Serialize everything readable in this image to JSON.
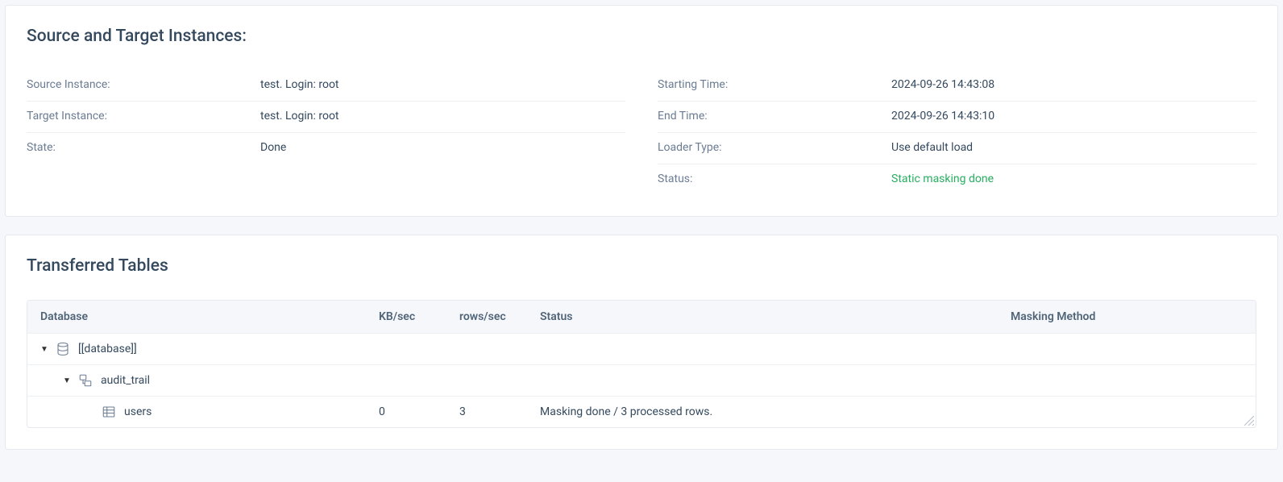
{
  "sections": {
    "instances_title": "Source and Target Instances:",
    "tables_title": "Transferred Tables"
  },
  "instances": {
    "source_label": "Source Instance:",
    "source_value": "test. Login: root",
    "target_label": "Target Instance:",
    "target_value": "test. Login: root",
    "state_label": "State:",
    "state_value": "Done",
    "start_label": "Starting Time:",
    "start_value": "2024-09-26 14:43:08",
    "end_label": "End Time:",
    "end_value": "2024-09-26 14:43:10",
    "loader_label": "Loader Type:",
    "loader_value": "Use default load",
    "status_label": "Status:",
    "status_value": "Static masking done"
  },
  "table": {
    "headers": {
      "database": "Database",
      "kb": "KB/sec",
      "rows": "rows/sec",
      "status": "Status",
      "method": "Masking Method"
    },
    "rows": {
      "db_name": "[[database]]",
      "schema_name": "audit_trail",
      "table_name": "users",
      "kb": "0",
      "rps": "3",
      "status": "Masking done / 3 processed rows.",
      "method": ""
    }
  }
}
